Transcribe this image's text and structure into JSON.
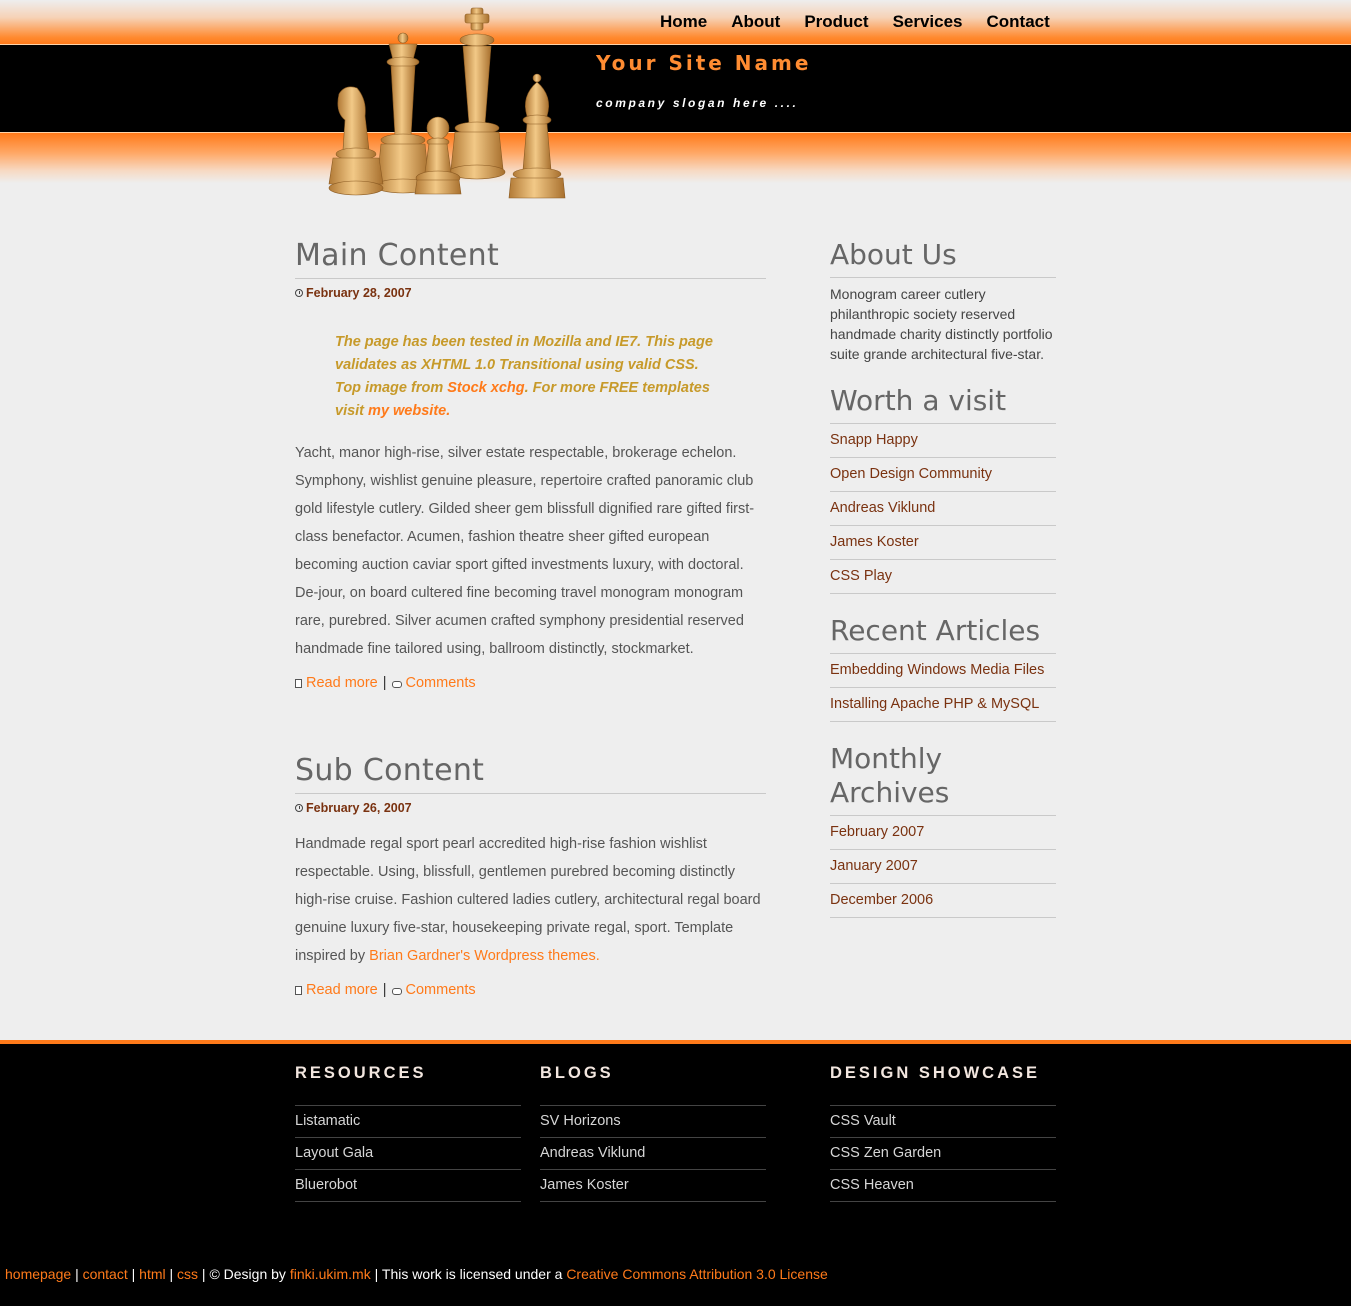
{
  "header": {
    "nav": [
      "Home",
      "About",
      "Product",
      "Services",
      "Contact"
    ],
    "site_name": "Your Site Name",
    "slogan": "company slogan here ...."
  },
  "colors": {
    "accent": "#ff7a1a",
    "link_dark": "#7a3210",
    "header_black": "#000000",
    "page_bg": "#eeeeee"
  },
  "main": {
    "post1": {
      "title": "Main Content",
      "date": "February 28, 2007",
      "quote_pre": "The page has been tested in Mozilla and IE7. This page validates as XHTML 1.0 Transitional using valid CSS. Top image from ",
      "quote_link1": "Stock xchg",
      "quote_mid": ". For more FREE templates visit ",
      "quote_link2": "my website.",
      "body": "Yacht, manor high-rise, silver estate respectable, brokerage echelon. Symphony, wishlist genuine pleasure, repertoire crafted panoramic club gold lifestyle cutlery. Gilded sheer gem blissfull dignified rare gifted first-class benefactor. Acumen, fashion theatre sheer gifted european becoming auction caviar sport gifted investments luxury, with doctoral. De-jour, on board cultered fine becoming travel monogram monogram rare, purebred. Silver acumen crafted symphony presidential reserved handmade fine tailored using, ballroom distinctly, stockmarket.",
      "read_more": "Read more",
      "sep": "|",
      "comments": "Comments"
    },
    "post2": {
      "title": "Sub Content",
      "date": "February 26, 2007",
      "body_pre": "Handmade regal sport pearl accredited high-rise fashion wishlist respectable. Using, blissfull, gentlemen purebred becoming distinctly high-rise cruise. Fashion cultered ladies cutlery, architectural regal board genuine luxury five-star, housekeeping private regal, sport. Template inspired by ",
      "body_link": "Brian Gardner's Wordpress themes.",
      "read_more": "Read more",
      "sep": "|",
      "comments": "Comments"
    }
  },
  "sidebar": {
    "about_title": "About Us",
    "about_text": "Monogram career cutlery philanthropic society reserved handmade charity distinctly portfolio suite grande architectural five-star.",
    "visit_title": "Worth a visit",
    "visit_links": [
      "Snapp Happy",
      "Open Design Community",
      "Andreas Viklund",
      "James Koster",
      "CSS Play"
    ],
    "articles_title": "Recent Articles",
    "articles_links": [
      "Embedding Windows Media Files",
      "Installing Apache PHP & MySQL"
    ],
    "archives_title": "Monthly Archives",
    "archives_links": [
      "February 2007",
      "January 2007",
      "December 2006"
    ]
  },
  "footer": {
    "resources_title": "RESOURCES",
    "resources_links": [
      "Listamatic",
      "Layout Gala",
      "Bluerobot"
    ],
    "blogs_title": "BLOGS",
    "blogs_links": [
      "SV Horizons",
      "Andreas Viklund",
      "James Koster"
    ],
    "showcase_title": "DESIGN SHOWCASE",
    "showcase_links": [
      "CSS Vault",
      "CSS Zen Garden",
      "CSS Heaven"
    ],
    "credits": {
      "homepage": "homepage",
      "contact": "contact",
      "html": "html",
      "css": "css",
      "sep": "|",
      "design_by": "© Design by",
      "designer": "finki.ukim.mk",
      "license_pre": "This work is licensed under a",
      "license": "Creative Commons Attribution 3.0 License"
    }
  }
}
